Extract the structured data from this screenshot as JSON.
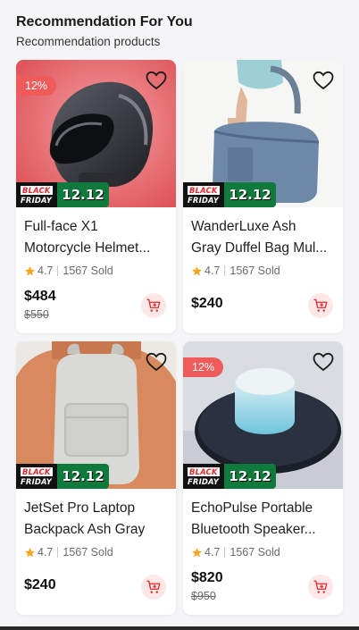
{
  "section": {
    "title": "Recommendation For You",
    "subtitle": "Recommendation products"
  },
  "promo": {
    "line1": "BLACK",
    "line2": "FRIDAY",
    "date": "12.12"
  },
  "colors": {
    "discount": "#ef5a5a",
    "promo_green": "#0f7a3c",
    "star": "#f5a623",
    "cart_bg": "#fde8e8",
    "cart_icon": "#e8272b"
  },
  "products": [
    {
      "name_line1": "Full-face X1",
      "name_line2": "Motorcycle Helmet...",
      "rating": "4.7",
      "sold": "1567 Sold",
      "price": "$484",
      "old_price": "$550",
      "discount": "12%",
      "image": "helmet"
    },
    {
      "name_line1": "WanderLuxe Ash",
      "name_line2": "Gray Duffel Bag Mul...",
      "rating": "4.7",
      "sold": "1567 Sold",
      "price": "$240",
      "old_price": "",
      "discount": "",
      "image": "duffel-bag"
    },
    {
      "name_line1": "JetSet Pro Laptop",
      "name_line2": "Backpack Ash Gray",
      "rating": "4.7",
      "sold": "1567 Sold",
      "price": "$240",
      "old_price": "",
      "discount": "",
      "image": "backpack"
    },
    {
      "name_line1": "EchoPulse Portable",
      "name_line2": "Bluetooth Speaker...",
      "rating": "4.7",
      "sold": "1567 Sold",
      "price": "$820",
      "old_price": "$950",
      "discount": "12%",
      "image": "speaker"
    }
  ],
  "icons": {
    "favorite": "heart-outline-icon",
    "cart": "cart-add-icon",
    "rating": "star-icon"
  }
}
